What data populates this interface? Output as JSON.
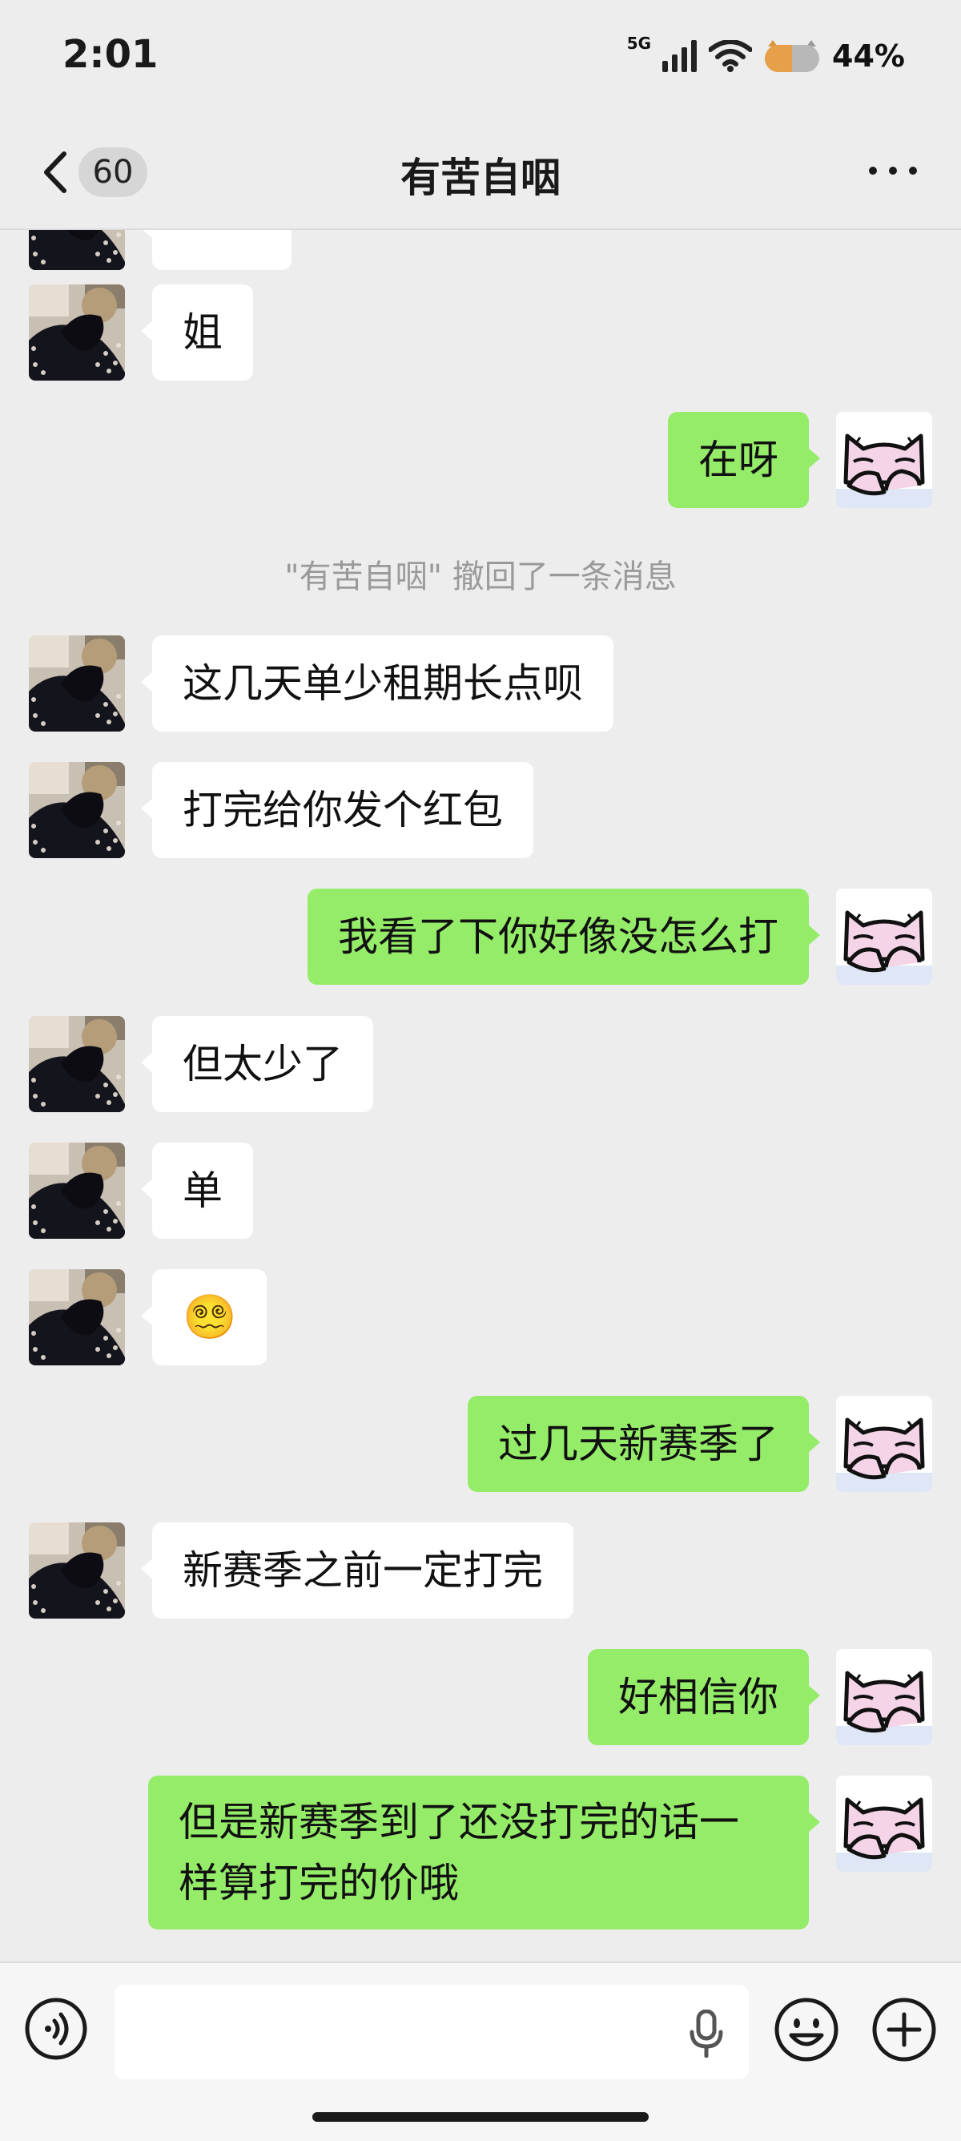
{
  "status_bar": {
    "time": "2:01",
    "network": "5G",
    "battery": "44%"
  },
  "nav": {
    "unread_count": "60",
    "title": "有苦自咽"
  },
  "messages": [
    {
      "side": "in",
      "text": "姐"
    },
    {
      "side": "out",
      "text": "在呀"
    },
    {
      "side": "system",
      "text": "\"有苦自咽\" 撤回了一条消息"
    },
    {
      "side": "in",
      "text": "这几天单少租期长点呗"
    },
    {
      "side": "in",
      "text": "打完给你发个红包"
    },
    {
      "side": "out",
      "text": "我看了下你好像没怎么打"
    },
    {
      "side": "in",
      "text": "但太少了"
    },
    {
      "side": "in",
      "text": "单"
    },
    {
      "side": "in",
      "text": "😵‍💫"
    },
    {
      "side": "out",
      "text": "过几天新赛季了"
    },
    {
      "side": "in",
      "text": "新赛季之前一定打完"
    },
    {
      "side": "out",
      "text": "好相信你"
    },
    {
      "side": "out",
      "text": "但是新赛季到了还没打完的话一样算打完的价哦"
    }
  ],
  "input_bar": {
    "placeholder": ""
  },
  "colors": {
    "background": "#ededed",
    "outgoing_bubble": "#95ec69",
    "incoming_bubble": "#ffffff"
  },
  "icons": {
    "back": "chevron-left-icon",
    "more": "more-dots-icon",
    "voice": "voice-input-icon",
    "mic": "microphone-icon",
    "emoji": "emoji-icon",
    "plus": "plus-icon"
  }
}
